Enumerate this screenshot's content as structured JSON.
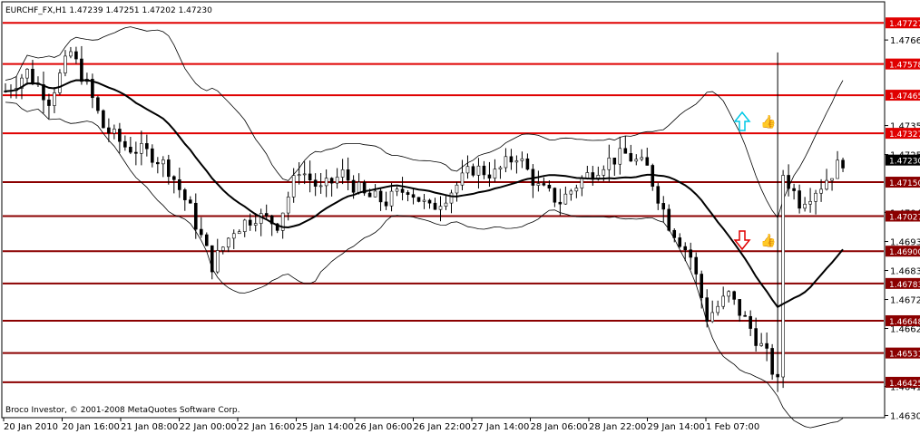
{
  "header": {
    "title": "EURCHF_FX,H1  1.47239 1.47251 1.47202 1.47230",
    "copyright": "Broco Investor, © 2001-2008 MetaQuotes Software Corp."
  },
  "chart_data": {
    "type": "candlestick",
    "symbol": "EURCHF_FX",
    "timeframe": "H1",
    "ohlc_last": {
      "open": 1.47239,
      "high": 1.47251,
      "low": 1.47202,
      "close": 1.4723
    },
    "ylim": [
      1.463,
      1.478
    ],
    "y_ticks": [
      "1.47665",
      "1.47355",
      "1.47250",
      "1.47040",
      "1.46935",
      "1.46830",
      "1.46725",
      "1.46620",
      "1.46410",
      "1.46305"
    ],
    "x_ticks": [
      "20 Jan 2010",
      "20 Jan 16:00",
      "21 Jan 08:00",
      "22 Jan 00:00",
      "22 Jan 16:00",
      "25 Jan 14:00",
      "26 Jan 06:00",
      "26 Jan 22:00",
      "27 Jan 14:00",
      "28 Jan 06:00",
      "28 Jan 22:00",
      "29 Jan 14:00",
      "1 Feb 07:00"
    ],
    "current_price": {
      "value": 1.4723,
      "label": "1.47230",
      "color": "#000000"
    },
    "levels": [
      {
        "value": 1.47727,
        "label": "1.47727",
        "color": "#e00000"
      },
      {
        "value": 1.47578,
        "label": "1.47578",
        "color": "#e00000"
      },
      {
        "value": 1.47465,
        "label": "1.47465",
        "color": "#e00000"
      },
      {
        "value": 1.47327,
        "label": "1.47327",
        "color": "#e00000"
      },
      {
        "value": 1.4715,
        "label": "1.47150",
        "color": "#8b0000"
      },
      {
        "value": 1.47027,
        "label": "1.47027",
        "color": "#8b0000"
      },
      {
        "value": 1.469,
        "label": "1.46900",
        "color": "#8b0000"
      },
      {
        "value": 1.46783,
        "label": "1.46783",
        "color": "#8b0000"
      },
      {
        "value": 1.46648,
        "label": "1.46648",
        "color": "#8b0000"
      },
      {
        "value": 1.46531,
        "label": "1.46531",
        "color": "#8b0000"
      },
      {
        "value": 1.46425,
        "label": "1.46425",
        "color": "#8b0000"
      }
    ],
    "price_path": [
      [
        0,
        1.4748
      ],
      [
        4,
        1.4755
      ],
      [
        8,
        1.4745
      ],
      [
        12,
        1.4762
      ],
      [
        15,
        1.475
      ],
      [
        18,
        1.4735
      ],
      [
        22,
        1.4728
      ],
      [
        27,
        1.4725
      ],
      [
        30,
        1.472
      ],
      [
        34,
        1.4705
      ],
      [
        38,
        1.4685
      ],
      [
        42,
        1.4698
      ],
      [
        46,
        1.4703
      ],
      [
        50,
        1.47
      ],
      [
        54,
        1.472
      ],
      [
        58,
        1.4712
      ],
      [
        62,
        1.4718
      ],
      [
        66,
        1.471
      ],
      [
        70,
        1.4708
      ],
      [
        74,
        1.4713
      ],
      [
        78,
        1.4705
      ],
      [
        82,
        1.4712
      ],
      [
        86,
        1.472
      ],
      [
        90,
        1.4718
      ],
      [
        94,
        1.4725
      ],
      [
        98,
        1.4713
      ],
      [
        102,
        1.4708
      ],
      [
        106,
        1.4716
      ],
      [
        110,
        1.4722
      ],
      [
        114,
        1.4725
      ],
      [
        118,
        1.472
      ],
      [
        122,
        1.47
      ],
      [
        126,
        1.4688
      ],
      [
        129,
        1.4666
      ],
      [
        133,
        1.4674
      ],
      [
        137,
        1.4662
      ],
      [
        140,
        1.4652
      ],
      [
        142,
        1.4642
      ],
      [
        143,
        1.4718
      ],
      [
        146,
        1.4708
      ],
      [
        150,
        1.4714
      ],
      [
        154,
        1.4723
      ]
    ],
    "indicators": [
      "Moving Average",
      "Bollinger Bands"
    ],
    "annotations": [
      {
        "type": "arrow-up",
        "color": "#00c8e6",
        "value": 1.4737
      },
      {
        "type": "thumbs-up",
        "color": "#00c8e6",
        "value": 1.4737
      },
      {
        "type": "arrow-down",
        "color": "#e00000",
        "value": 1.4694
      },
      {
        "type": "thumbs-up",
        "color": "#00c8e6",
        "value": 1.4694
      }
    ]
  }
}
